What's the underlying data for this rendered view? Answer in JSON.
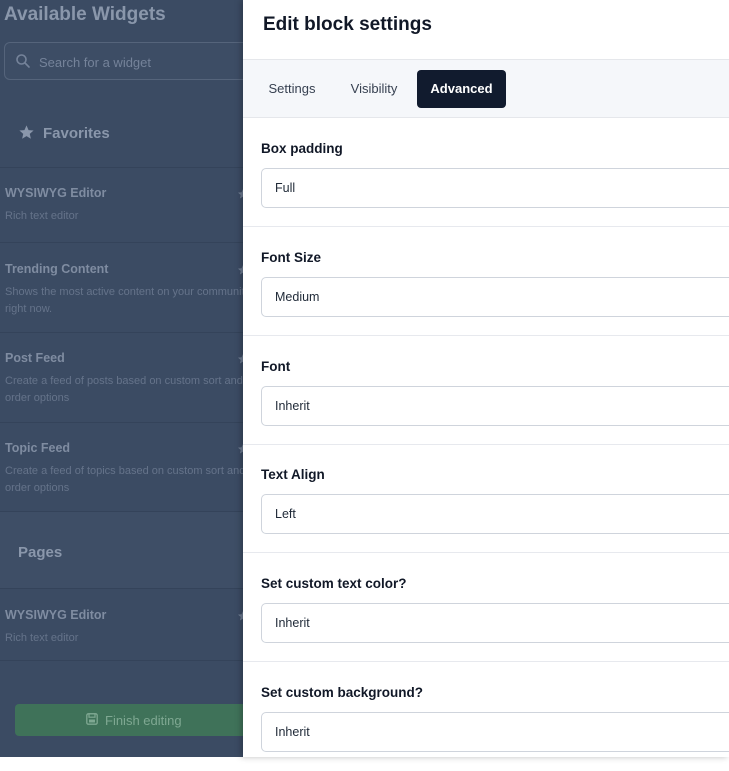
{
  "sidebar": {
    "title": "Available Widgets",
    "search_placeholder": "Search for a widget",
    "favorites_label": "Favorites",
    "favorites": [
      {
        "name": "WYSIWYG Editor",
        "description": "Rich text editor"
      },
      {
        "name": "Trending Content",
        "description": "Shows the most active content on your community right now."
      },
      {
        "name": "Post Feed",
        "description": "Create a feed of posts based on custom sort and order options"
      },
      {
        "name": "Topic Feed",
        "description": "Create a feed of topics based on custom sort and order options"
      }
    ],
    "pages_label": "Pages",
    "pages": [
      {
        "name": "WYSIWYG Editor",
        "description": "Rich text editor"
      }
    ],
    "finish_label": "Finish editing"
  },
  "panel": {
    "title": "Edit block settings",
    "tabs": [
      {
        "label": "Settings"
      },
      {
        "label": "Visibility"
      },
      {
        "label": "Advanced"
      }
    ],
    "active_tab": "Advanced",
    "fields": [
      {
        "label": "Box padding",
        "value": "Full"
      },
      {
        "label": "Font Size",
        "value": "Medium"
      },
      {
        "label": "Font",
        "value": "Inherit"
      },
      {
        "label": "Text Align",
        "value": "Left"
      },
      {
        "label": "Set custom text color?",
        "value": "Inherit"
      },
      {
        "label": "Set custom background?",
        "value": "Inherit"
      }
    ]
  },
  "colors": {
    "active_tab_bg": "#111b2e",
    "finish_button_bg": "#3f7259",
    "sidebar_bg": "#3b4b63"
  }
}
